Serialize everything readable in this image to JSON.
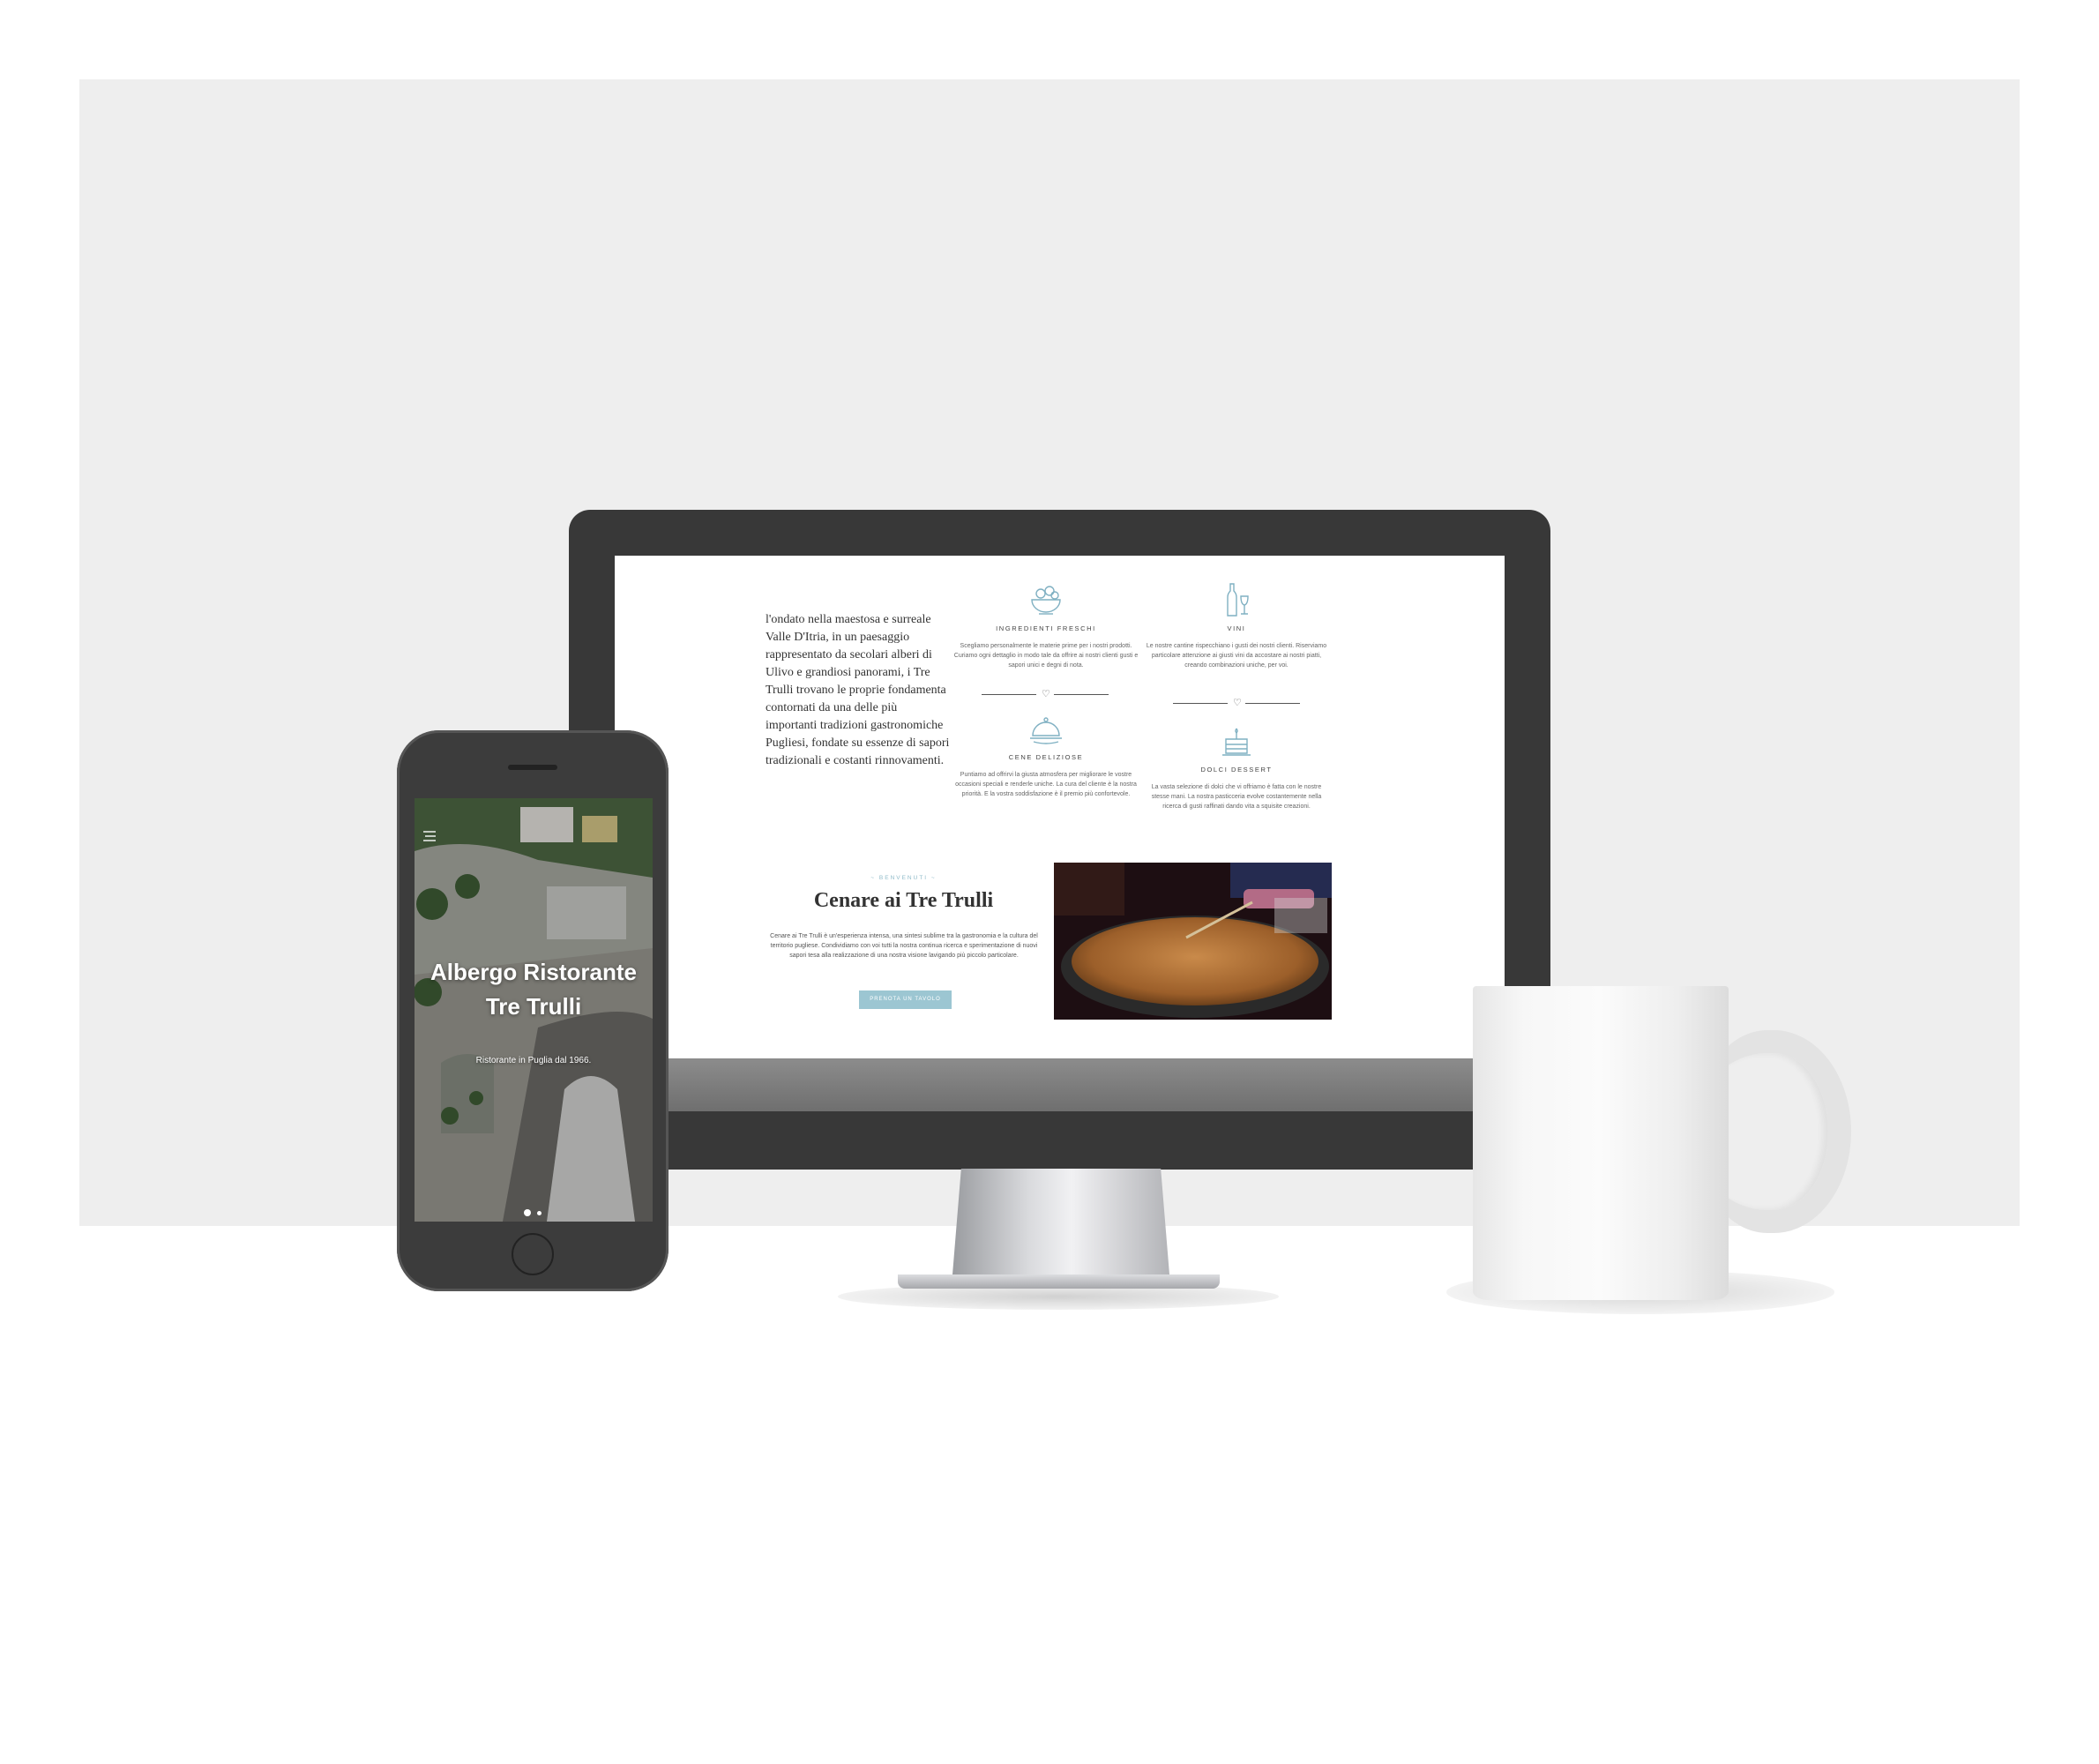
{
  "desktop": {
    "intro_paragraph": "l'ondato nella maestosa e surreale Valle D'Itria, in un paesaggio rappresentato da secolari alberi di Ulivo e grandiosi panorami, i Tre Trulli trovano le proprie fondamenta contornati da una delle più importanti tradizioni gastronomiche Pugliesi, fondate su essenze di sapori tradizionali e costanti rinnovamenti.",
    "features": [
      {
        "icon": "salad-bowl-icon",
        "title": "INGREDIENTI FRESCHI",
        "text": "Scegliamo personalmente le materie prime per i nostri prodotti. Curiamo ogni dettaglio in modo tale da offrire ai nostri clienti gusti e sapori unici e degni di nota."
      },
      {
        "icon": "wine-bottle-icon",
        "title": "VINI",
        "text": "Le nostre cantine rispecchiano i gusti dei nostri clienti. Riserviamo particolare attenzione ai giusti vini da accostare ai nostri piatti, creando combinazioni uniche, per voi."
      },
      {
        "icon": "cloche-icon",
        "title": "CENE DELIZIOSE",
        "text": "Puntiamo ad offrirvi la giusta atmosfera per migliorare le vostre occasioni speciali e renderle uniche. La cura del cliente è la nostra priorità. E la vostra soddisfazione è il premio più confortevole."
      },
      {
        "icon": "cake-icon",
        "title": "DOLCI DESSERT",
        "text": "La vasta selezione di dolci che vi offriamo è fatta con le nostre stesse mani. La nostra pasticceria evolve costantemente nella ricerca di gusti raffinati dando vita a squisite creazioni."
      }
    ],
    "welcome": {
      "kicker": "~ BENVENUTI ~",
      "title": "Cenare ai Tre Trulli",
      "text": "Cenare ai Tre Trulli è un'esperienza intensa, una sintesi sublime tra la gastronomia e la cultura del territorio pugliese. Condividiamo con voi tutti la nostra continua ricerca e sperimentazione di nuovi sapori tesa alla realizzazione di una nostra visione lavigando più piccolo particolare.",
      "button": "PRENOTA UN TAVOLO"
    }
  },
  "phone": {
    "hero_title": "Albergo Ristorante Tre Trulli",
    "hero_subtitle": "Ristorante in Puglia dal 1966.",
    "slides": 2,
    "active_slide": 1
  },
  "colors": {
    "accent": "#9cc6d2",
    "device_frame": "#383838",
    "backdrop": "#eeeeee"
  }
}
